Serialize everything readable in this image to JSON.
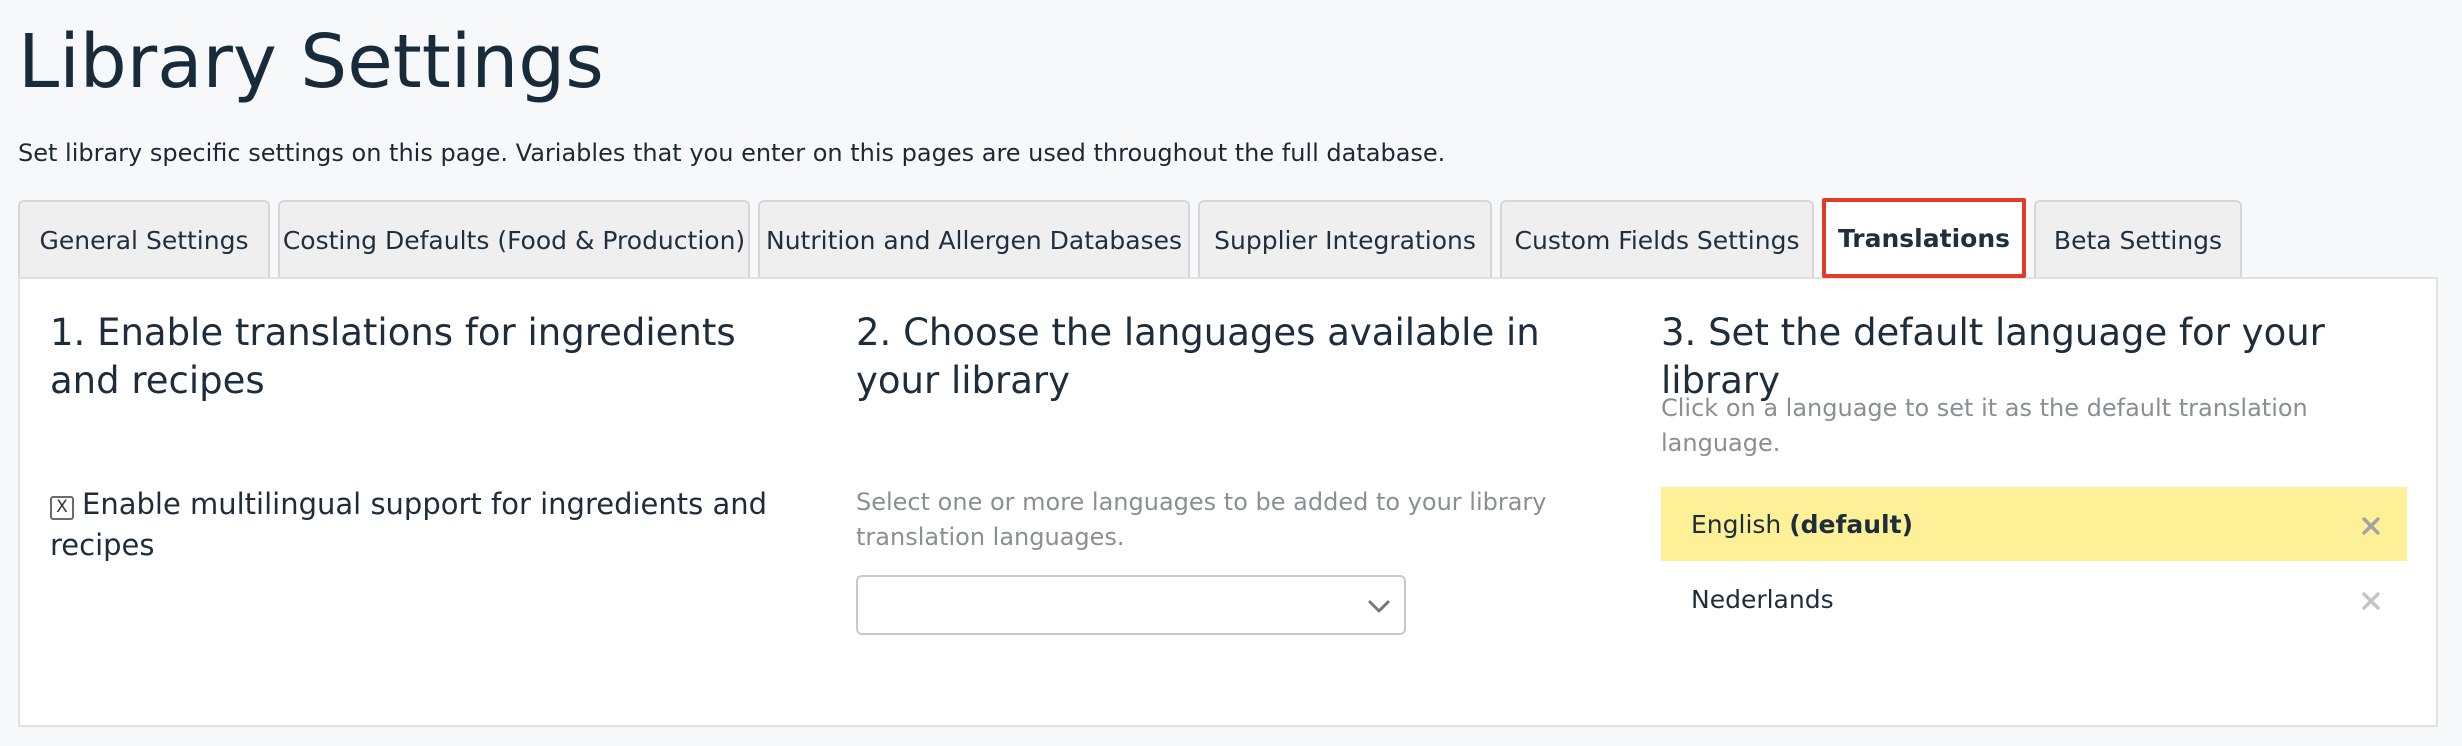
{
  "page": {
    "title": "Library Settings",
    "description": "Set library specific settings on this page. Variables that you enter on this pages are used throughout the full database."
  },
  "tabs": [
    {
      "label": "General Settings",
      "active": false
    },
    {
      "label": "Costing Defaults (Food & Production)",
      "active": false
    },
    {
      "label": "Nutrition and Allergen Databases",
      "active": false
    },
    {
      "label": "Supplier Integrations",
      "active": false
    },
    {
      "label": "Custom Fields Settings",
      "active": false
    },
    {
      "label": "Translations",
      "active": true
    },
    {
      "label": "Beta Settings",
      "active": false
    }
  ],
  "section1": {
    "heading": "1. Enable translations for ingredients and recipes",
    "checkbox_mark": "X",
    "checkbox_label": "Enable multilingual support for ingredients and recipes",
    "checked": true
  },
  "section2": {
    "heading": "2. Choose the languages available in your library",
    "hint": "Select one or more languages to be added to your library translation languages.",
    "select_value": ""
  },
  "section3": {
    "heading": "3. Set the default language for your library",
    "hint": "Click on a language to set it as the default translation language.",
    "languages": [
      {
        "name": "English",
        "suffix": "(default)",
        "is_default": true
      },
      {
        "name": "Nederlands",
        "suffix": "",
        "is_default": false
      }
    ]
  },
  "colors": {
    "active_tab_border": "#e23b27",
    "default_language_bg": "#fdf097",
    "hint_text": "#8a8f94"
  },
  "icons": {
    "checkbox": "checkbox-checked-icon",
    "select_arrow": "chevron-down-icon",
    "remove": "close-icon"
  }
}
